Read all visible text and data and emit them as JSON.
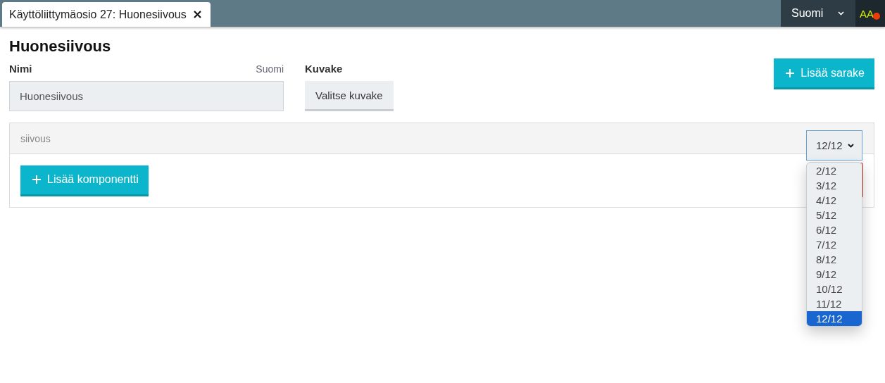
{
  "tab": {
    "title": "Käyttöliittymäosio 27: Huonesiivous",
    "selected": true
  },
  "language_menu": {
    "label": "Suomi"
  },
  "accessibility_button": {
    "label": "AA",
    "notification": true
  },
  "heading": "Huonesiivous",
  "name_field": {
    "label": "Nimi",
    "language": "Suomi",
    "value": "Huonesiivous"
  },
  "icon_field": {
    "label": "Kuvake",
    "button": "Valitse kuvake"
  },
  "add_column_button": "Lisää sarake",
  "section": {
    "title": "siivous",
    "add_component_button": "Lisää komponentti",
    "width_select": {
      "value": "12/12",
      "expanded": true,
      "options": [
        {
          "label": "2/12",
          "selected": false
        },
        {
          "label": "3/12",
          "selected": false
        },
        {
          "label": "4/12",
          "selected": false
        },
        {
          "label": "5/12",
          "selected": false
        },
        {
          "label": "6/12",
          "selected": false
        },
        {
          "label": "7/12",
          "selected": false
        },
        {
          "label": "8/12",
          "selected": false
        },
        {
          "label": "9/12",
          "selected": false
        },
        {
          "label": "10/12",
          "selected": false
        },
        {
          "label": "11/12",
          "selected": false
        },
        {
          "label": "12/12",
          "selected": true
        }
      ]
    }
  }
}
